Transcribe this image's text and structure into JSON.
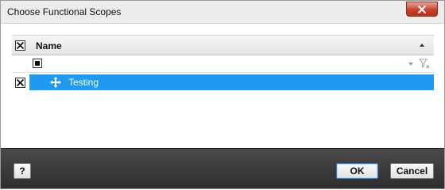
{
  "dialog": {
    "title": "Choose Functional Scopes"
  },
  "grid": {
    "header": {
      "name_label": "Name",
      "select_all_checked": true,
      "sort": "ascending"
    },
    "filter_row": {
      "checkbox_state": "indeterminate",
      "filter_value": ""
    },
    "rows": [
      {
        "label": "Testing",
        "checked": true,
        "selected": true,
        "icon": "move-icon"
      }
    ]
  },
  "footer": {
    "help_label": "?",
    "ok_label": "OK",
    "cancel_label": "Cancel"
  },
  "colors": {
    "selection": "#1e9bf0",
    "close_button": "#c7412b",
    "footer_bg": "#3a3a3a"
  }
}
